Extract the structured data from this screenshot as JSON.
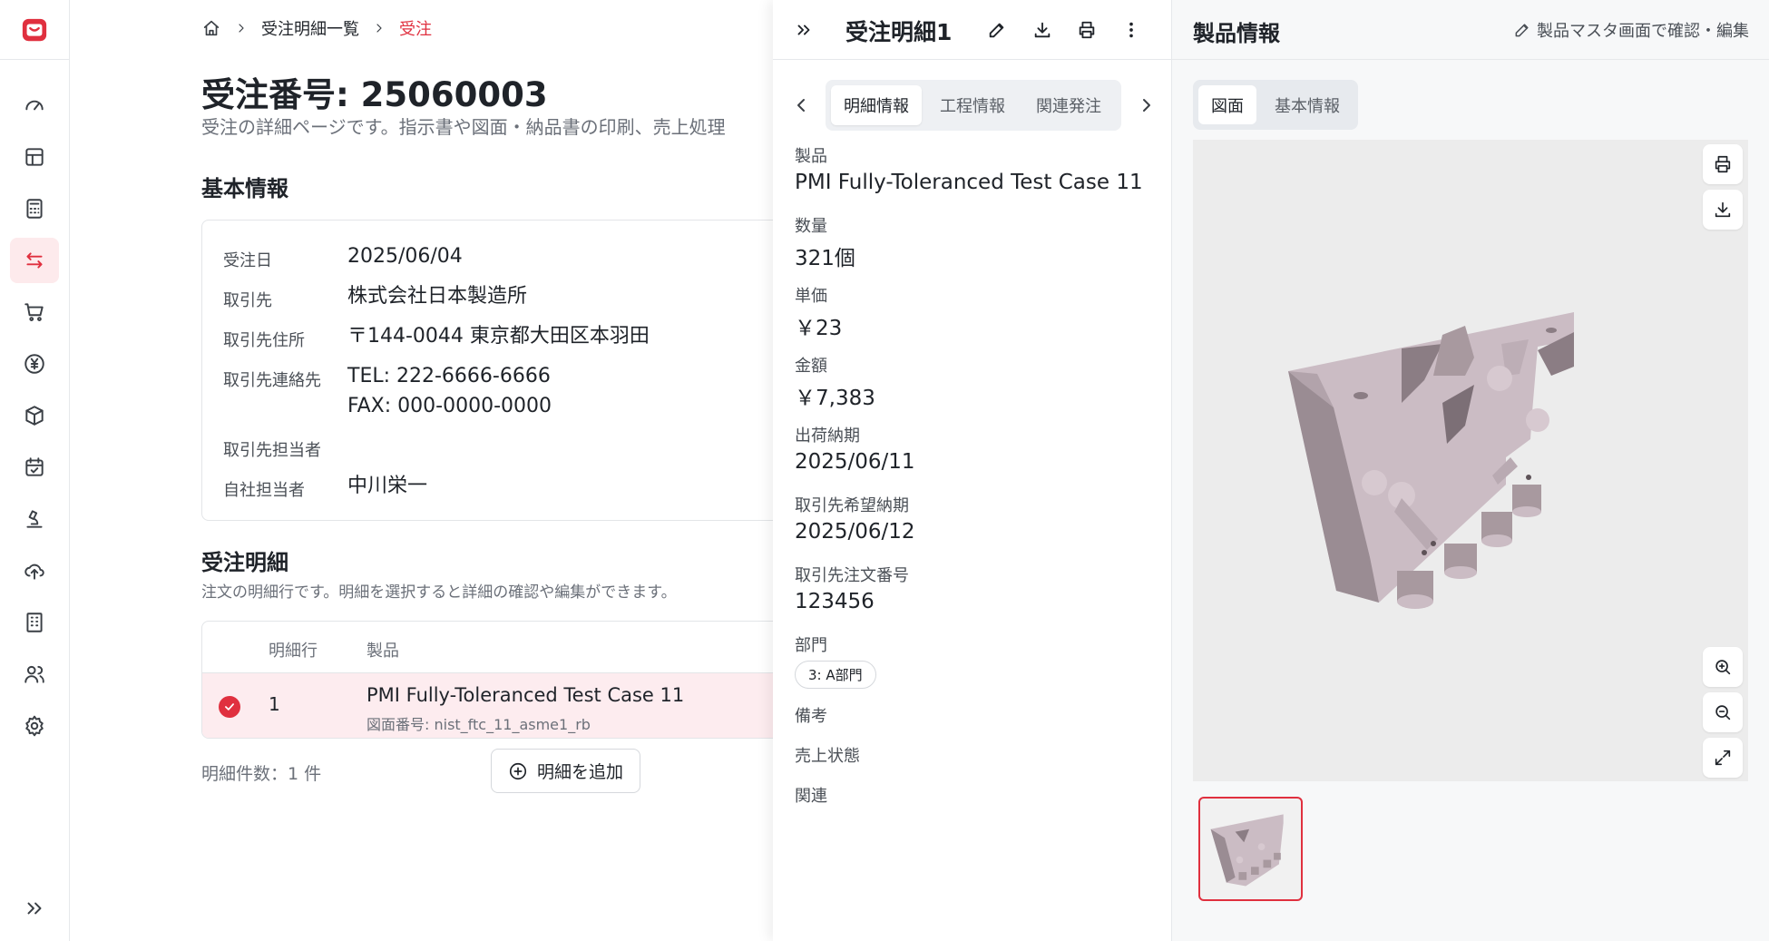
{
  "breadcrumb": {
    "list": "受注明細一覧",
    "current": "受注"
  },
  "page": {
    "title": "受注番号: 25060003",
    "description": "受注の詳細ページです。指示書や図面・納品書の印刷、売上処理"
  },
  "basic_info": {
    "heading": "基本情報",
    "rows": [
      {
        "label": "受注日",
        "value": "2025/06/04"
      },
      {
        "label": "取引先",
        "value": "株式会社日本製造所"
      },
      {
        "label": "取引先住所",
        "value": "〒144-0044 東京都大田区本羽田"
      },
      {
        "label": "取引先連絡先",
        "value": "TEL: 222-6666-6666",
        "value2": "FAX: 000-0000-0000"
      },
      {
        "label": "取引先担当者",
        "value": ""
      },
      {
        "label": "自社担当者",
        "value": "中川栄一"
      }
    ]
  },
  "order_lines": {
    "heading": "受注明細",
    "description": "注文の明細行です。明細を選択すると詳細の確認や編集ができます。",
    "columns": [
      "明細行",
      "製品"
    ],
    "rows": [
      {
        "line": "1",
        "product": "PMI Fully-Toleranced Test Case 11",
        "drawing": "図面番号: nist_ftc_11_asme1_rb"
      }
    ],
    "count_text": "明細件数：1 件",
    "add_label": "明細を追加"
  },
  "detail_panel": {
    "title": "受注明細1",
    "tabs": [
      "明細情報",
      "工程情報",
      "関連発注"
    ],
    "fields": [
      {
        "label": "製品",
        "value": "PMI Fully-Toleranced Test Case 11"
      },
      {
        "label": "数量",
        "value": "321個"
      },
      {
        "label": "単価",
        "value": "￥23"
      },
      {
        "label": "金額",
        "value": "￥7,383"
      },
      {
        "label": "出荷納期",
        "value": "2025/06/11"
      },
      {
        "label": "取引先希望納期",
        "value": "2025/06/12"
      },
      {
        "label": "取引先注文番号",
        "value": "123456"
      }
    ],
    "department_label": "部門",
    "department_value": "3: A部門",
    "remarks_label": "備考",
    "sales_status_label": "売上状態",
    "related_label": "関連"
  },
  "product_panel": {
    "title": "製品情報",
    "master_link": "製品マスタ画面で確認・編集",
    "tabs": [
      "図面",
      "基本情報"
    ]
  },
  "colors": {
    "accent": "#e0303f",
    "model": "#cbbcc4"
  }
}
